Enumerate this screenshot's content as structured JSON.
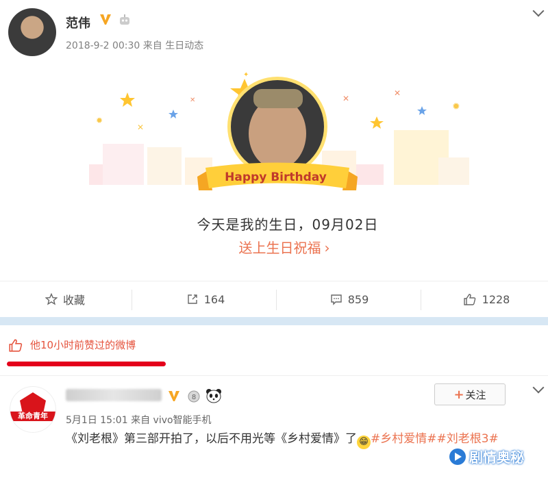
{
  "post1": {
    "author": "范伟",
    "time": "2018-9-2 00:30",
    "source_prefix": "来自",
    "source": "生日动态",
    "birthday_banner": "Happy Birthday",
    "birthday_text": "今天是我的生日，09月02日",
    "blessing_link": "送上生日祝福",
    "actions": {
      "favorite": "收藏",
      "forward": "164",
      "comment": "859",
      "like": "1228"
    }
  },
  "liked_notice": "他10小时前赞过的微博",
  "post2": {
    "avatar_text": "革命青年",
    "time": "5月1日 15:01",
    "source_prefix": "来自",
    "source": "vivo智能手机",
    "follow_label": "关注",
    "content_main": "《刘老根》第三部开拍了，以后不用光等《乡村爱情》了",
    "tag1": "#乡村爱情#",
    "tag2": "#刘老根3#"
  },
  "watermark": "剧情奥秘",
  "colors": {
    "accent_orange": "#eb7350",
    "red_line": "#e4001b",
    "band_blue": "#d7e7f4",
    "verified_gold": "#f6a623"
  }
}
